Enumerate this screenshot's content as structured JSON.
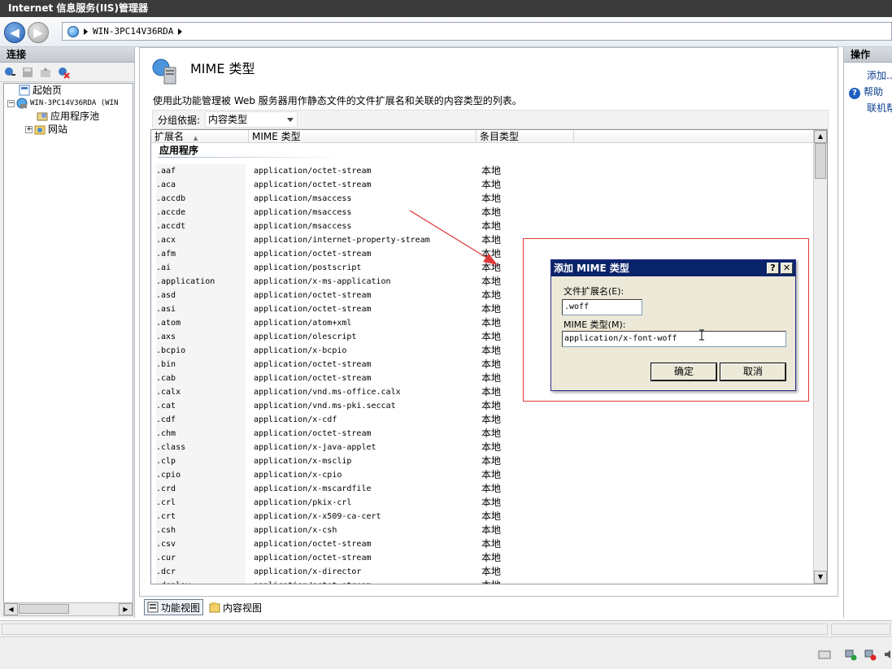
{
  "window": {
    "title": "Internet 信息服务(IIS)管理器"
  },
  "nav": {
    "address_parts": [
      "WIN-3PC14V36RDA"
    ]
  },
  "connections": {
    "header": "连接",
    "tree": {
      "start_page": "起始页",
      "server": "WIN-3PC14V36RDA (WIN",
      "app_pools": "应用程序池",
      "sites": "网站"
    }
  },
  "main": {
    "title": "MIME 类型",
    "description": "使用此功能管理被 Web 服务器用作静态文件的文件扩展名和关联的内容类型的列表。",
    "group_by_label": "分组依据:",
    "group_by_value": "内容类型",
    "columns": [
      "扩展名",
      "MIME 类型",
      "条目类型"
    ],
    "group_title": "应用程序",
    "rows": [
      {
        "ext": ".aaf",
        "mime": "application/octet-stream",
        "type": "本地"
      },
      {
        "ext": ".aca",
        "mime": "application/octet-stream",
        "type": "本地"
      },
      {
        "ext": ".accdb",
        "mime": "application/msaccess",
        "type": "本地"
      },
      {
        "ext": ".accde",
        "mime": "application/msaccess",
        "type": "本地"
      },
      {
        "ext": ".accdt",
        "mime": "application/msaccess",
        "type": "本地"
      },
      {
        "ext": ".acx",
        "mime": "application/internet-property-stream",
        "type": "本地"
      },
      {
        "ext": ".afm",
        "mime": "application/octet-stream",
        "type": "本地"
      },
      {
        "ext": ".ai",
        "mime": "application/postscript",
        "type": "本地"
      },
      {
        "ext": ".application",
        "mime": "application/x-ms-application",
        "type": "本地"
      },
      {
        "ext": ".asd",
        "mime": "application/octet-stream",
        "type": "本地"
      },
      {
        "ext": ".asi",
        "mime": "application/octet-stream",
        "type": "本地"
      },
      {
        "ext": ".atom",
        "mime": "application/atom+xml",
        "type": "本地"
      },
      {
        "ext": ".axs",
        "mime": "application/olescript",
        "type": "本地"
      },
      {
        "ext": ".bcpio",
        "mime": "application/x-bcpio",
        "type": "本地"
      },
      {
        "ext": ".bin",
        "mime": "application/octet-stream",
        "type": "本地"
      },
      {
        "ext": ".cab",
        "mime": "application/octet-stream",
        "type": "本地"
      },
      {
        "ext": ".calx",
        "mime": "application/vnd.ms-office.calx",
        "type": "本地"
      },
      {
        "ext": ".cat",
        "mime": "application/vnd.ms-pki.seccat",
        "type": "本地"
      },
      {
        "ext": ".cdf",
        "mime": "application/x-cdf",
        "type": "本地"
      },
      {
        "ext": ".chm",
        "mime": "application/octet-stream",
        "type": "本地"
      },
      {
        "ext": ".class",
        "mime": "application/x-java-applet",
        "type": "本地"
      },
      {
        "ext": ".clp",
        "mime": "application/x-msclip",
        "type": "本地"
      },
      {
        "ext": ".cpio",
        "mime": "application/x-cpio",
        "type": "本地"
      },
      {
        "ext": ".crd",
        "mime": "application/x-mscardfile",
        "type": "本地"
      },
      {
        "ext": ".crl",
        "mime": "application/pkix-crl",
        "type": "本地"
      },
      {
        "ext": ".crt",
        "mime": "application/x-x509-ca-cert",
        "type": "本地"
      },
      {
        "ext": ".csh",
        "mime": "application/x-csh",
        "type": "本地"
      },
      {
        "ext": ".csv",
        "mime": "application/octet-stream",
        "type": "本地"
      },
      {
        "ext": ".cur",
        "mime": "application/octet-stream",
        "type": "本地"
      },
      {
        "ext": ".dcr",
        "mime": "application/x-director",
        "type": "本地"
      },
      {
        "ext": ".deploy",
        "mime": "application/octet-stream",
        "type": "本地"
      }
    ]
  },
  "view_tabs": {
    "feature_view": "功能视图",
    "content_view": "内容视图"
  },
  "actions": {
    "header": "操作",
    "add": "添加...",
    "help": "帮助",
    "online_help": "联机帮助"
  },
  "dialog": {
    "title": "添加 MIME 类型",
    "ext_label": "文件扩展名(E):",
    "ext_value": ".woff",
    "mime_label": "MIME 类型(M):",
    "mime_value": "application/x-font-woff",
    "ok": "确定",
    "cancel": "取消",
    "help_glyph": "?",
    "close_glyph": "✕"
  },
  "colors": {
    "titlebar": "#3b3b3b",
    "dialog_title": "#0a246a",
    "annotation": "#e03a3a",
    "link": "#0b3f8e"
  }
}
